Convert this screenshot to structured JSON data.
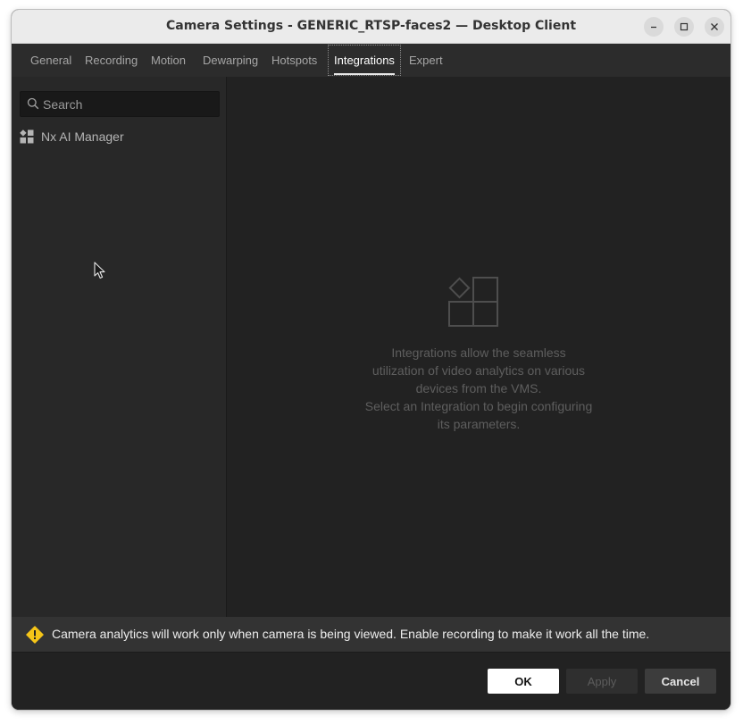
{
  "window": {
    "title": "Camera Settings - GENERIC_RTSP-faces2 — Desktop Client",
    "controls": [
      "minimize-icon",
      "maximize-icon",
      "close-icon"
    ]
  },
  "tabs": [
    {
      "label": "General",
      "active": false
    },
    {
      "label": "Recording",
      "active": false
    },
    {
      "label": "Motion",
      "active": false
    },
    {
      "label": "Dewarping",
      "active": false
    },
    {
      "label": "Hotspots",
      "active": false
    },
    {
      "label": "Integrations",
      "active": true
    },
    {
      "label": "Expert",
      "active": false
    }
  ],
  "sidebar": {
    "search": {
      "placeholder": "Search",
      "value": "",
      "icon": "search-icon"
    },
    "items": [
      {
        "label": "Nx AI Manager",
        "icon": "integration-grid-icon"
      }
    ]
  },
  "main": {
    "empty_state": {
      "icon": "integrations-placeholder-icon",
      "lines": [
        "Integrations allow the seamless",
        "utilization of video analytics on various",
        "devices from the VMS.",
        "Select an Integration to begin configuring",
        "its parameters."
      ]
    }
  },
  "warning": {
    "icon": "warning-icon",
    "text": "Camera analytics will work only when camera is being viewed. Enable recording to make it work all the time."
  },
  "footer": {
    "ok_label": "OK",
    "apply_label": "Apply",
    "cancel_label": "Cancel",
    "apply_enabled": false
  },
  "colors": {
    "background": "#222222",
    "sidebar": "#282828",
    "tabbar": "#2c2c2c",
    "warning_yellow": "#f5c518",
    "text_muted": "#5e5e5e",
    "titlebar": "#ebebeb"
  }
}
